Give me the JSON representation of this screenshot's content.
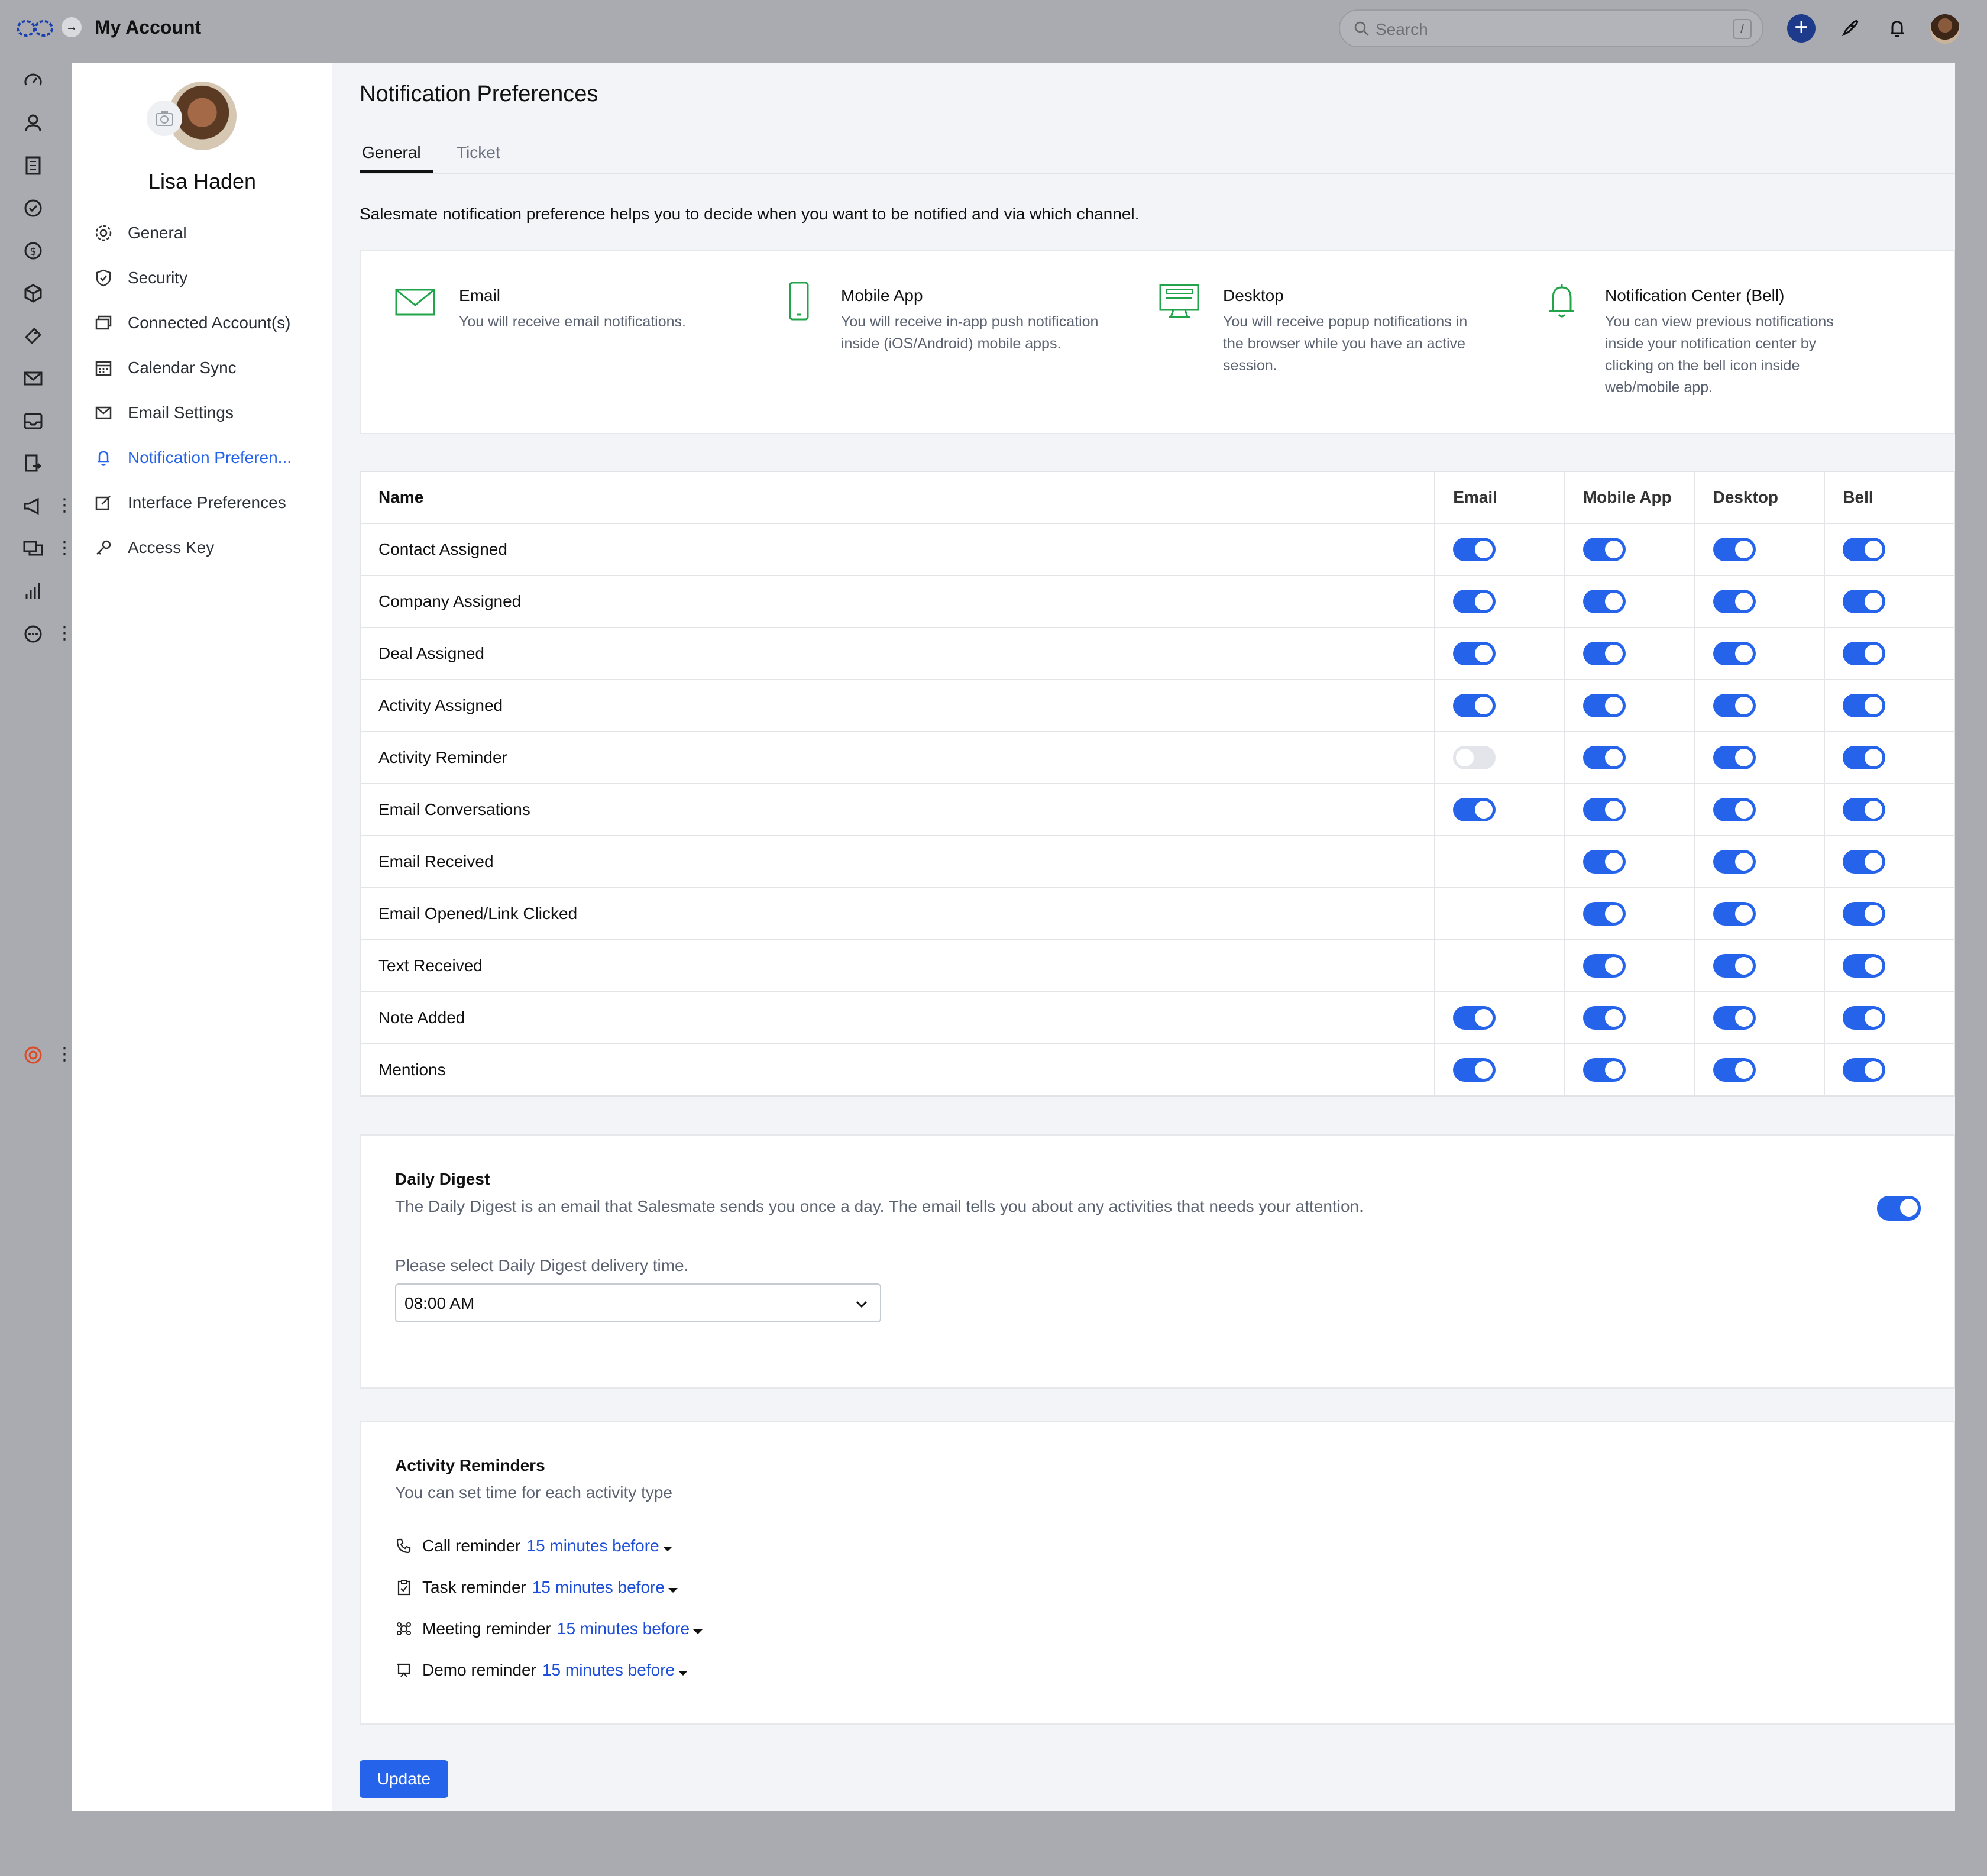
{
  "app": {
    "title": "My Account"
  },
  "search": {
    "placeholder": "Search",
    "shortcut": "/"
  },
  "profile": {
    "name": "Lisa Haden"
  },
  "sidebar": {
    "items": [
      {
        "label": "General",
        "icon": "gear-icon"
      },
      {
        "label": "Security",
        "icon": "shield-icon"
      },
      {
        "label": "Connected Account(s)",
        "icon": "connected-accounts-icon"
      },
      {
        "label": "Calendar Sync",
        "icon": "calendar-icon"
      },
      {
        "label": "Email Settings",
        "icon": "envelope-icon"
      },
      {
        "label": "Notification Preferen...",
        "icon": "bell-icon",
        "active": true
      },
      {
        "label": "Interface Preferences",
        "icon": "edit-icon"
      },
      {
        "label": "Access Key",
        "icon": "key-icon"
      }
    ]
  },
  "page": {
    "title": "Notification Preferences",
    "tabs": [
      {
        "label": "General",
        "active": true
      },
      {
        "label": "Ticket"
      }
    ],
    "intro": "Salesmate notification preference helps you to decide when you want to be notified and via which channel."
  },
  "channels": [
    {
      "title": "Email",
      "desc": "You will receive email notifications.",
      "icon": "envelope-icon"
    },
    {
      "title": "Mobile App",
      "desc": "You will receive in-app push notification inside (iOS/Android) mobile apps.",
      "icon": "mobile-icon"
    },
    {
      "title": "Desktop",
      "desc": "You will receive popup notifications in the browser while you have an active session.",
      "icon": "desktop-icon"
    },
    {
      "title": "Notification Center (Bell)",
      "desc": "You can view previous notifications inside your notification center by clicking on the bell icon inside web/mobile app.",
      "icon": "bell-icon"
    }
  ],
  "table": {
    "headers": [
      "Name",
      "Email",
      "Mobile App",
      "Desktop",
      "Bell"
    ],
    "rows": [
      {
        "name": "Contact Assigned",
        "email": true,
        "mobile": true,
        "desktop": true,
        "bell": true
      },
      {
        "name": "Company Assigned",
        "email": true,
        "mobile": true,
        "desktop": true,
        "bell": true
      },
      {
        "name": "Deal Assigned",
        "email": true,
        "mobile": true,
        "desktop": true,
        "bell": true
      },
      {
        "name": "Activity Assigned",
        "email": true,
        "mobile": true,
        "desktop": true,
        "bell": true
      },
      {
        "name": "Activity Reminder",
        "email": false,
        "mobile": true,
        "desktop": true,
        "bell": true
      },
      {
        "name": "Email Conversations",
        "email": true,
        "mobile": true,
        "desktop": true,
        "bell": true
      },
      {
        "name": "Email Received",
        "email": null,
        "mobile": true,
        "desktop": true,
        "bell": true
      },
      {
        "name": "Email Opened/Link Clicked",
        "email": null,
        "mobile": true,
        "desktop": true,
        "bell": true
      },
      {
        "name": "Text Received",
        "email": null,
        "mobile": true,
        "desktop": true,
        "bell": true
      },
      {
        "name": "Note Added",
        "email": true,
        "mobile": true,
        "desktop": true,
        "bell": true
      },
      {
        "name": "Mentions",
        "email": true,
        "mobile": true,
        "desktop": true,
        "bell": true
      }
    ]
  },
  "digest": {
    "title": "Daily Digest",
    "desc": "The Daily Digest is an email that Salesmate sends you once a day. The email tells you about any activities that needs your attention.",
    "enabled": true,
    "select_label": "Please select Daily Digest delivery time.",
    "selected_time": "08:00 AM"
  },
  "reminders": {
    "title": "Activity Reminders",
    "desc": "You can set time for each activity type",
    "items": [
      {
        "label": "Call reminder",
        "time": "15 minutes before",
        "icon": "phone-icon"
      },
      {
        "label": "Task reminder",
        "time": "15 minutes before",
        "icon": "clipboard-icon"
      },
      {
        "label": "Meeting reminder",
        "time": "15 minutes before",
        "icon": "meeting-icon"
      },
      {
        "label": "Demo reminder",
        "time": "15 minutes before",
        "icon": "presentation-icon"
      }
    ]
  },
  "actions": {
    "update_label": "Update"
  },
  "colors": {
    "accent": "#2563eb",
    "topbar": "#a9abb1",
    "toggle_off": "#e3e5ea",
    "channel_icon": "#22a54a"
  }
}
